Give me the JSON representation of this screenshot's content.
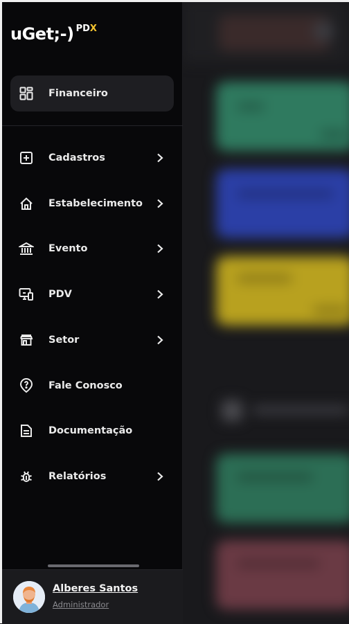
{
  "brand": {
    "logo_main": "uGet;-)",
    "logo_sub": "PD",
    "logo_x": "X"
  },
  "sidebar": {
    "active": {
      "label": "Financeiro",
      "icon": "dashboard-grid-icon"
    },
    "items": [
      {
        "label": "Cadastros",
        "icon": "plus-square-icon",
        "chevron": true
      },
      {
        "label": "Estabelecimento",
        "icon": "home-icon",
        "chevron": true
      },
      {
        "label": "Evento",
        "icon": "bank-icon",
        "chevron": true
      },
      {
        "label": "PDV",
        "icon": "monitor-device-icon",
        "chevron": true
      },
      {
        "label": "Setor",
        "icon": "storefront-icon",
        "chevron": true
      },
      {
        "label": "Fale Conosco",
        "icon": "help-pin-icon",
        "chevron": false
      },
      {
        "label": "Documentação",
        "icon": "document-icon",
        "chevron": false
      },
      {
        "label": "Relatórios",
        "icon": "bug-icon",
        "chevron": true
      }
    ]
  },
  "profile": {
    "name": "Alberes Santos",
    "role": "Administrador"
  },
  "colors": {
    "sidebar_bg": "#08080a",
    "active_bg": "#1e1e22",
    "logo_accent": "#f4c430",
    "bg_card_green": "#2f7a5f",
    "bg_card_blue": "#2b3fa6",
    "bg_card_yellow": "#b8a11f",
    "bg_card_red": "#6a3a44"
  }
}
